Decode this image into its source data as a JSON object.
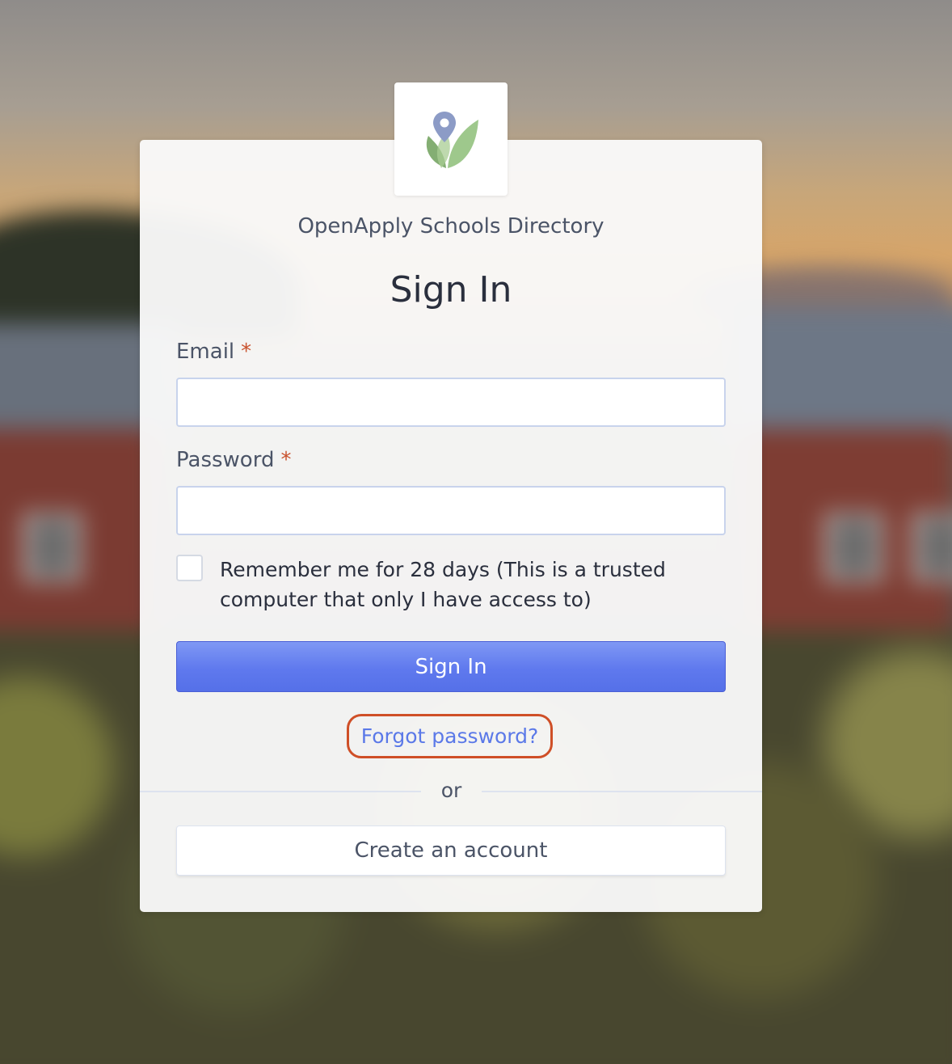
{
  "app": {
    "org_name": "OpenApply Schools Directory",
    "logo_icon": "openapply-leaf-pin-logo"
  },
  "form": {
    "title": "Sign In",
    "email_label": "Email",
    "password_label": "Password",
    "required_marker": "*",
    "email_value": "",
    "password_value": "",
    "remember_checked": false,
    "remember_text": "Remember me for 28 days (This is a trusted computer that only I have access to)",
    "submit_label": "Sign In",
    "forgot_label": "Forgot password?",
    "divider_text": "or",
    "create_label": "Create an account"
  },
  "colors": {
    "primary_button": "#5f79ee",
    "link": "#5b79e8",
    "required": "#c9522e",
    "highlight_ring": "#cf4f27",
    "logo_green": "#7fb36a",
    "logo_pin": "#8c9bc6"
  }
}
